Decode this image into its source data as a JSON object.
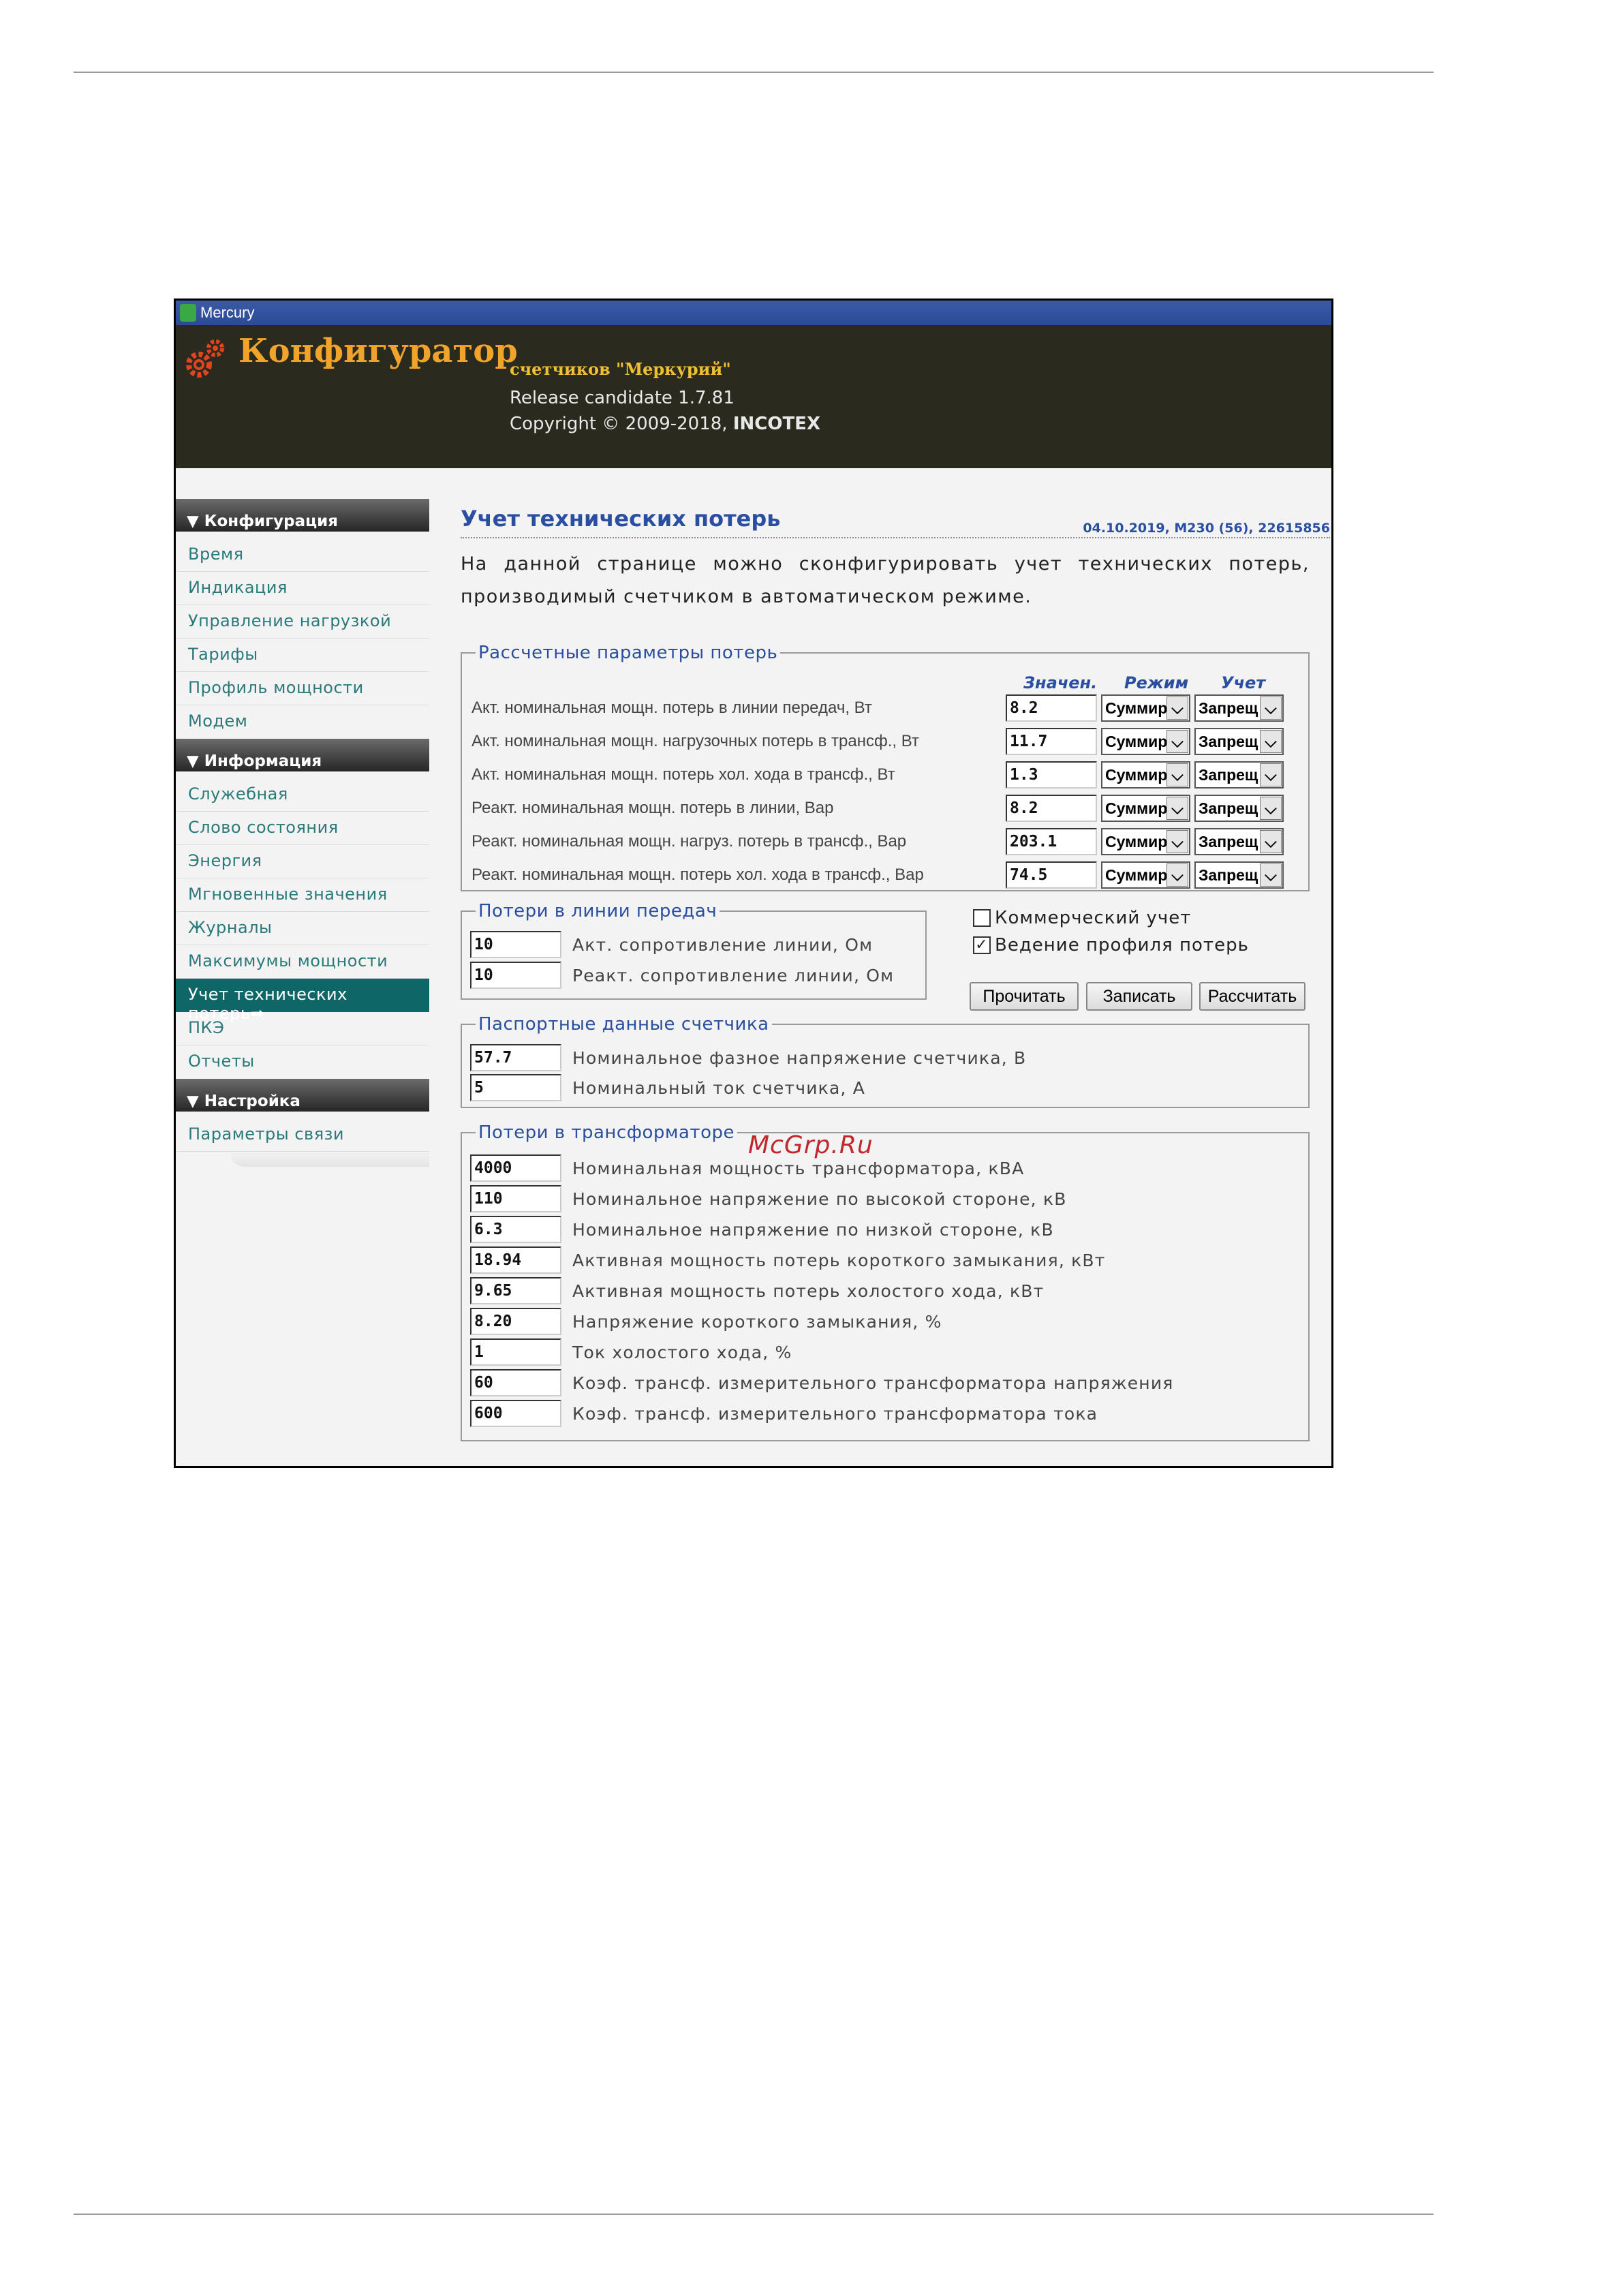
{
  "window": {
    "title": "Mercury"
  },
  "header": {
    "title": "Конфигуратор",
    "subtitle": "счетчиков \"Меркурий\"",
    "version": "Release candidate 1.7.81",
    "copyright_prefix": "Copyright © 2009-2018, ",
    "copyright_company": "INCOTEX"
  },
  "sidebar": {
    "sections": [
      {
        "title": "▼ Конфигурация",
        "items": [
          "Время",
          "Индикация",
          "Управление нагрузкой",
          "Тарифы",
          "Профиль мощности",
          "Модем"
        ]
      },
      {
        "title": "▼ Информация",
        "items": [
          "Служебная",
          "Слово состояния",
          "Энергия",
          "Мгновенные значения",
          "Журналы",
          "Максимумы мощности",
          "Учет технических потерь",
          "ПКЭ",
          "Отчеты"
        ]
      },
      {
        "title": "▼ Настройка",
        "items": [
          "Параметры связи"
        ]
      }
    ],
    "active_item": "Учет технических потерь"
  },
  "page": {
    "title": "Учет технических потерь",
    "meta": "04.10.2019, M230 (56), 22615856",
    "intro": "На данной странице можно сконфигурировать учет технических потерь, производимый счетчиком в автоматическом режиме."
  },
  "calc_params": {
    "legend": "Рассчетные параметры потерь",
    "col_value": "Значен.",
    "col_mode": "Режим",
    "col_account": "Учет",
    "rows": [
      {
        "label": "Акт. номинальная мощн. потерь в линии передач, Вт",
        "value": "8.2",
        "mode": "Суммир",
        "account": "Запрещ"
      },
      {
        "label": "Акт. номинальная мощн. нагрузочных потерь в трансф., Вт",
        "value": "11.7",
        "mode": "Суммир",
        "account": "Запрещ"
      },
      {
        "label": "Акт. номинальная мощн. потерь хол. хода в трансф., Вт",
        "value": "1.3",
        "mode": "Суммир",
        "account": "Запрещ"
      },
      {
        "label": "Реакт. номинальная мощн. потерь в линии, Вар",
        "value": "8.2",
        "mode": "Суммир",
        "account": "Запрещ"
      },
      {
        "label": "Реакт. номинальная мощн. нагруз. потерь в трансф., Вар",
        "value": "203.1",
        "mode": "Суммир",
        "account": "Запрещ"
      },
      {
        "label": "Реакт. номинальная мощн. потерь хол. хода в трансф., Вар",
        "value": "74.5",
        "mode": "Суммир",
        "account": "Запрещ"
      }
    ]
  },
  "line_losses": {
    "legend": "Потери в линии передач",
    "rows": [
      {
        "value": "10",
        "label": "Акт. сопротивление линии, Ом"
      },
      {
        "value": "10",
        "label": "Реакт. сопротивление линии, Ом"
      }
    ]
  },
  "options": {
    "commercial": {
      "label": "Коммерческий учет",
      "checked": false
    },
    "profile": {
      "label": "Ведение профиля потерь",
      "checked": true,
      "mark": "✓"
    }
  },
  "buttons": {
    "read": "Прочитать",
    "write": "Записать",
    "calc": "Рассчитать"
  },
  "passport": {
    "legend": "Паспортные данные счетчика",
    "rows": [
      {
        "value": "57.7",
        "label": "Номинальное фазное напряжение счетчика, В"
      },
      {
        "value": "5",
        "label": "Номинальный ток счетчика, А"
      }
    ]
  },
  "transformer": {
    "legend": "Потери в трансформаторе",
    "rows": [
      {
        "value": "4000",
        "label": "Номинальная мощность трансформатора, кВА"
      },
      {
        "value": "110",
        "label": "Номинальное напряжение по высокой стороне, кВ"
      },
      {
        "value": "6.3",
        "label": "Номинальное напряжение по низкой стороне, кВ"
      },
      {
        "value": "18.94",
        "label": "Активная мощность потерь короткого замыкания, кВт"
      },
      {
        "value": "9.65",
        "label": "Активная мощность потерь холостого хода, кВт"
      },
      {
        "value": "8.20",
        "label": "Напряжение короткого замыкания, %"
      },
      {
        "value": "1",
        "label": "Ток холостого хода, %"
      },
      {
        "value": "60",
        "label": "Коэф. трансф. измерительного трансформатора напряжения"
      },
      {
        "value": "600",
        "label": "Коэф. трансф. измерительного трансформатора тока"
      }
    ]
  },
  "watermark": "McGrp.Ru",
  "colors": {
    "accent": "#2a4ea0",
    "nav": "#2a7a7a",
    "active": "#0f6666",
    "header_bg": "#2b2a1e",
    "title_orange": "#f0a42a"
  }
}
